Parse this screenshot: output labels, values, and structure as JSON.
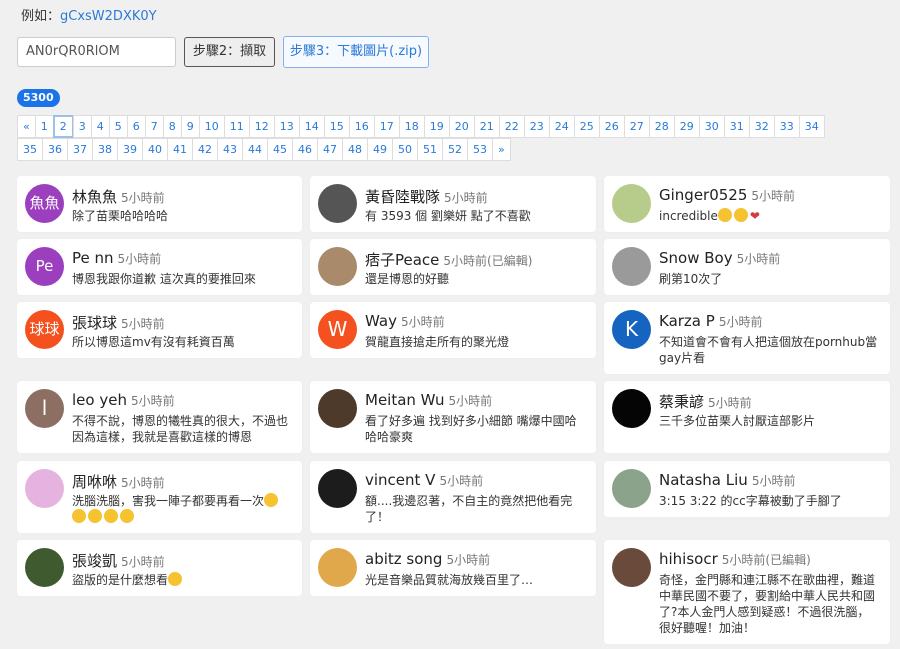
{
  "example": {
    "label": "例如：",
    "code": "gCxsW2DXK0Y"
  },
  "input": {
    "value": "AN0rQR0RlOM"
  },
  "buttons": {
    "step2": "步驟2：擷取",
    "step3": "步驟3：下載圖片(.zip)"
  },
  "count": "5300",
  "pagination": {
    "row1": [
      "«",
      "1",
      "2",
      "3",
      "4",
      "5",
      "6",
      "7",
      "8",
      "9",
      "10",
      "11",
      "12",
      "13",
      "14",
      "15",
      "16",
      "17",
      "18",
      "19",
      "20",
      "21",
      "22",
      "23",
      "24",
      "25",
      "26",
      "27",
      "28",
      "29",
      "30",
      "31",
      "32",
      "33",
      "34"
    ],
    "row2": [
      "35",
      "36",
      "37",
      "38",
      "39",
      "40",
      "41",
      "42",
      "43",
      "44",
      "45",
      "46",
      "47",
      "48",
      "49",
      "50",
      "51",
      "52",
      "53",
      "»"
    ],
    "active": "2"
  },
  "comments": [
    {
      "name": "林魚魚",
      "time": "5小時前",
      "text": "除了苗栗哈哈哈哈",
      "avatar_text": "魚魚",
      "avatar_color": "#9c3fbf"
    },
    {
      "name": "黃昏陸戰隊",
      "time": "5小時前",
      "text": "有 3593 個 劉樂妍 點了不喜歡",
      "avatar_text": "",
      "avatar_color": "#555555"
    },
    {
      "name": "Ginger0525",
      "time": "5小時前",
      "text": "incredible",
      "avatar_text": "",
      "avatar_color": "#b7cc8a"
    },
    {
      "name": "Pe nn",
      "time": "5小時前",
      "text": "博恩我跟你道歉 這次真的要推回來",
      "avatar_text": "Pe",
      "avatar_color": "#9c3fbf"
    },
    {
      "name": "痞子Peace",
      "time": "5小時前(已編輯)",
      "text": "還是博恩的好聽",
      "avatar_text": "",
      "avatar_color": "#a98a6a"
    },
    {
      "name": "Snow Boy",
      "time": "5小時前",
      "text": "刷第10次了",
      "avatar_text": "",
      "avatar_color": "#9a9a9a"
    },
    {
      "name": "張球球",
      "time": "5小時前",
      "text": "所以博恩這mv有沒有耗資百萬",
      "avatar_text": "球球",
      "avatar_color": "#f4511e"
    },
    {
      "name": "Way",
      "time": "5小時前",
      "text": "賀龍直接搶走所有的聚光燈",
      "avatar_text": "W",
      "avatar_color": "#f4511e"
    },
    {
      "name": "Karza P",
      "time": "5小時前",
      "text": "不知道會不會有人把這個放在pornhub當gay片看",
      "avatar_text": "K",
      "avatar_color": "#1565c0"
    },
    {
      "name": "leo yeh",
      "time": "5小時前",
      "text": "不得不說，博恩的犧牲真的很大，不過也因為這樣，我就是喜歡這樣的博恩",
      "avatar_text": "l",
      "avatar_color": "#8d6e63"
    },
    {
      "name": "Meitan Wu",
      "time": "5小時前",
      "text": "看了好多遍 找到好多小細節 嘴爆中國哈哈哈豪爽",
      "avatar_text": "",
      "avatar_color": "#4e3a2a"
    },
    {
      "name": "蔡秉諺",
      "time": "5小時前",
      "text": "三千多位苗栗人討厭這部影片",
      "avatar_text": "",
      "avatar_color": "#050505"
    },
    {
      "name": "周咻咻",
      "time": "5小時前",
      "text": "洗腦洗腦，害我一陣子都要再看一次",
      "avatar_text": "",
      "avatar_color": "#e6b3e0"
    },
    {
      "name": "vincent V",
      "time": "5小時前",
      "text": "額....我邊忍著，不自主的竟然把他看完了！",
      "avatar_text": "",
      "avatar_color": "#1c1c1c"
    },
    {
      "name": "Natasha Liu",
      "time": "5小時前",
      "text": "3:15 3:22 的cc字幕被動了手腳了",
      "avatar_text": "",
      "avatar_color": "#8aa38a"
    },
    {
      "name": "張竣凱",
      "time": "5小時前",
      "text": "盜版的是什麼想看",
      "avatar_text": "",
      "avatar_color": "#3f5a2e"
    },
    {
      "name": "abitz song",
      "time": "5小時前",
      "text": "光是音樂品質就海放幾百里了…",
      "avatar_text": "",
      "avatar_color": "#e0a84a"
    },
    {
      "name": "hihisocr",
      "time": "5小時前(已編輯)",
      "text": "奇怪，金門縣和連江縣不在歌曲裡，難道中華民國不要了，要割給中華人民共和國了?本人金門人感到疑惑！不過很洗腦，很好聽喔！加油！",
      "avatar_text": "",
      "avatar_color": "#6a4a3a"
    }
  ],
  "colors": {
    "accent": "#2a7ad8",
    "badge": "#1a73e8",
    "background": "#f0f0f0"
  }
}
